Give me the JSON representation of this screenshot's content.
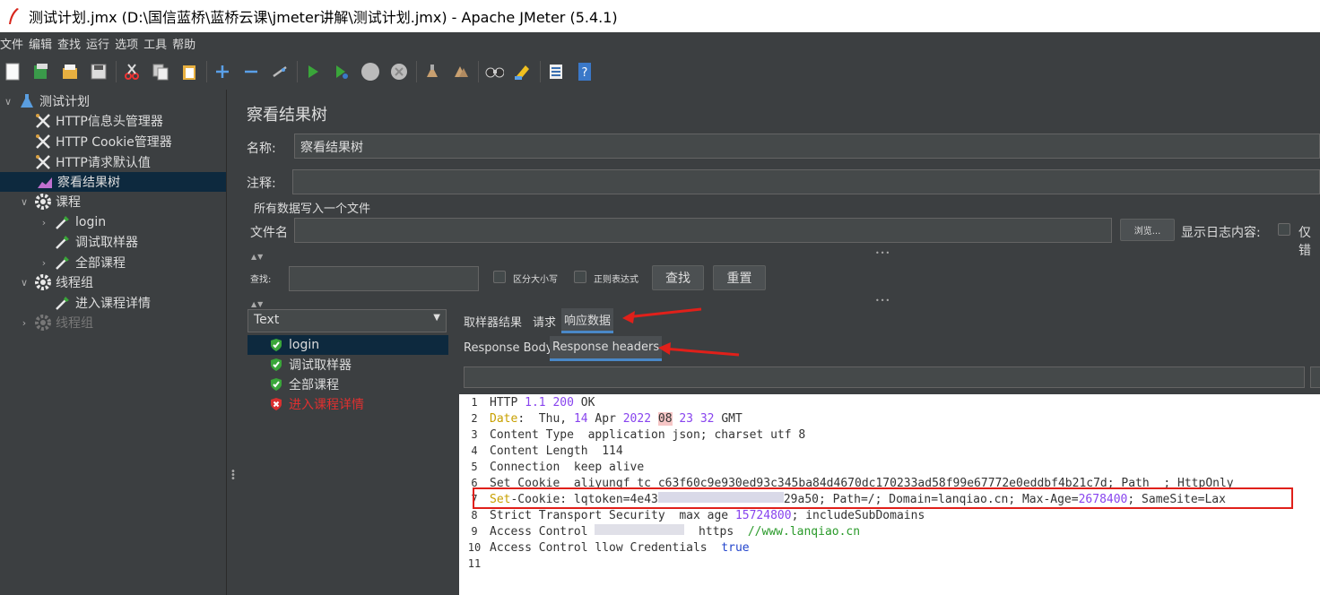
{
  "window": {
    "title": "测试计划.jmx (D:\\国信蓝桥\\蓝桥云课\\jmeter讲解\\测试计划.jmx) - Apache JMeter (5.4.1)"
  },
  "menu": [
    "文件",
    "编辑",
    "查找",
    "运行",
    "选项",
    "工具",
    "帮助"
  ],
  "toolbar_icons": [
    "new-icon",
    "templates-icon",
    "open-icon",
    "save-icon",
    "cut-icon",
    "copy-icon",
    "paste-icon",
    "expand-icon",
    "collapse-icon",
    "toggle-icon",
    "start-icon",
    "start-no-pause-icon",
    "stop-icon",
    "shutdown-icon",
    "clear-icon",
    "clear-all-icon",
    "search-icon",
    "reset-search-icon",
    "function-helper-icon",
    "help-icon"
  ],
  "tree": {
    "items": [
      {
        "label": "测试计划"
      },
      {
        "label": "HTTP信息头管理器"
      },
      {
        "label": "HTTP Cookie管理器"
      },
      {
        "label": "HTTP请求默认值"
      },
      {
        "label": "察看结果树"
      },
      {
        "label": "课程"
      },
      {
        "label": "login"
      },
      {
        "label": "调试取样器"
      },
      {
        "label": "全部课程"
      },
      {
        "label": "线程组"
      },
      {
        "label": "进入课程详情"
      },
      {
        "label": "线程组"
      }
    ]
  },
  "panel": {
    "title": "察看结果树",
    "name_label": "名称:",
    "name_value": "察看结果树",
    "comment_label": "注释:",
    "comment_value": "",
    "write_all_label": "所有数据写入一个文件",
    "filename_label": "文件名",
    "browse_button": "浏览...",
    "log_content_label": "显示日志内容:",
    "only_errors_label": "仅错",
    "search_label": "查找:",
    "case_sensitive_label": "区分大小写",
    "regex_label": "正则表达式",
    "find_button": "查找",
    "reset_button": "重置"
  },
  "results": {
    "renderer": "Text",
    "items": [
      {
        "label": "login",
        "status": "success"
      },
      {
        "label": "调试取样器",
        "status": "success"
      },
      {
        "label": "全部课程",
        "status": "success"
      },
      {
        "label": "进入课程详情",
        "status": "error"
      }
    ],
    "tabs": [
      "取样器结果",
      "请求",
      "响应数据"
    ],
    "active_tab": "响应数据",
    "subtabs": [
      "Response Body",
      "Response headers"
    ],
    "active_subtab": "Response headers"
  },
  "headers": {
    "line_numbers": [
      "1",
      "2",
      "3",
      "4",
      "5",
      "6",
      "7",
      "8",
      "9",
      "10",
      "11"
    ],
    "l1": {
      "a": "HTTP",
      "b": " 1.1 200 ",
      "c": "OK"
    },
    "l2": {
      "a": "Date",
      "b": ":  Thu, ",
      "c": "14",
      "d": " Apr ",
      "e": "2022",
      "f": " ",
      "g": "08",
      "h": " 23 32",
      "i": " GMT"
    },
    "l3": "Content Type  application json; charset utf 8",
    "l4": "Content Length  114",
    "l5": "Connection  keep alive",
    "l6": "Set Cookie  aliyungf tc c63f60c9e930ed93c345ba84d4670dc170233ad58f99e67772e0eddbf4b21c7d; Path  ; HttpOnly",
    "l7": {
      "a": "Set",
      "b": "-Cookie: lqtoken=4e43",
      "c": "29a50; Path=/; Domain=lanqiao.cn; Max-Age=",
      "d": "2678400",
      "e": "; SameSite=Lax"
    },
    "l8": {
      "a": "Strict Transport Security  max age ",
      "b": "15724800",
      "c": "; includeSubDomains"
    },
    "l9": {
      "a": "Access Control ",
      "b": "  https  ",
      "c": "//www.lanqiao.cn"
    },
    "l10": {
      "a": "Access Control ",
      "b": "llow Credentials  ",
      "c": "true"
    },
    "l11": ""
  },
  "colors": {
    "annotation": "#e0201a",
    "accent": "#4a88c7",
    "selection": "#0d293e"
  }
}
